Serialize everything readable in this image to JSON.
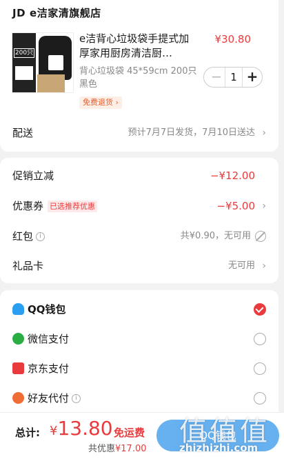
{
  "shop": {
    "brand": "JD",
    "name": "e洁家清旗舰店"
  },
  "product": {
    "title": "e洁背心垃圾袋手提式加厚家用厨房清洁厨…",
    "price": "¥30.80",
    "spec": "背心垃圾袋 45*59cm 200只 黑色",
    "return_tag": "免费退货 ›",
    "quantity": "1",
    "minus": "−",
    "plus": "+",
    "thumb_count_text": "200只"
  },
  "delivery": {
    "label": "配送",
    "value": "预计7月7日发货，7月10日送达"
  },
  "discounts": {
    "promo": {
      "label": "促销立减",
      "value": "−¥12.00"
    },
    "coupon": {
      "label": "优惠券",
      "tag": "已选推荐优惠",
      "value": "−¥5.00"
    },
    "redpacket": {
      "label": "红包",
      "value": "共¥0.90，无可用"
    },
    "giftcard": {
      "label": "礼品卡",
      "value": "无可用"
    }
  },
  "payment": {
    "methods": [
      {
        "label": "QQ钱包",
        "icon": "qq-wallet-icon",
        "selected": true
      },
      {
        "label": "微信支付",
        "icon": "wechat-pay-icon",
        "selected": false
      },
      {
        "label": "京东支付",
        "icon": "jd-pay-icon",
        "selected": false
      },
      {
        "label": "好友代付",
        "icon": "friend-pay-icon",
        "selected": false
      }
    ]
  },
  "footer": {
    "total_label": "总计:",
    "currency": "¥",
    "total": "13.80",
    "free_shipping": "免运费",
    "saved_prefix": "共优惠",
    "saved": "¥17.00",
    "pay_button": "QQ钱包"
  },
  "watermark": {
    "big": "值值值",
    "small": "zhizhizhi.com"
  },
  "colors": {
    "accent": "#e93b3d",
    "pay_button": "#56a8ee"
  }
}
